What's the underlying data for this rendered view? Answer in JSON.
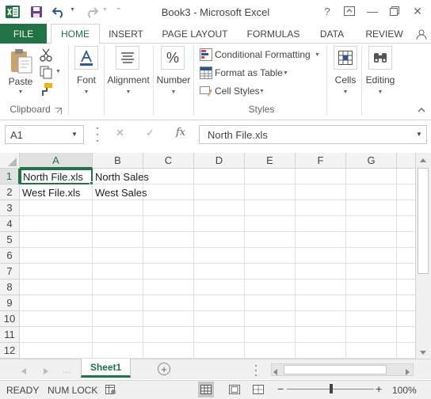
{
  "window": {
    "title": "Book3 - Microsoft Excel",
    "help_label": "?",
    "minimize_label": "—",
    "close_label": "✕",
    "brand_color": "#217346"
  },
  "tabs": {
    "file": "FILE",
    "home": "HOME",
    "insert": "INSERT",
    "page_layout": "PAGE LAYOUT",
    "formulas": "FORMULAS",
    "data": "DATA",
    "review": "REVIEW"
  },
  "ribbon": {
    "paste": "Paste",
    "clipboard_group": "Clipboard",
    "font": "Font",
    "alignment": "Alignment",
    "number": "Number",
    "number_glyph": "%",
    "conditional_formatting": "Conditional Formatting",
    "format_as_table": "Format as Table",
    "cell_styles": "Cell Styles",
    "styles_group": "Styles",
    "cells": "Cells",
    "editing": "Editing"
  },
  "formula_bar": {
    "name_box": "A1",
    "cancel_glyph": "✕",
    "enter_glyph": "✓",
    "fx_label": "fx",
    "value": "North File.xls"
  },
  "grid": {
    "columns": [
      "A",
      "B",
      "C",
      "D",
      "E",
      "F",
      "G"
    ],
    "rows": [
      "1",
      "2",
      "3",
      "4",
      "5",
      "6",
      "7",
      "8",
      "9",
      "10",
      "11",
      "12"
    ],
    "cells": {
      "A1": "North File.xls",
      "B1": "North Sales",
      "A2": "West File.xls",
      "B2": "West Sales"
    }
  },
  "sheets": {
    "active": "Sheet1",
    "add_glyph": "+"
  },
  "status": {
    "ready": "READY",
    "num_lock": "NUM LOCK",
    "zoom": "100%",
    "zoom_minus": "−",
    "zoom_plus": "+"
  }
}
